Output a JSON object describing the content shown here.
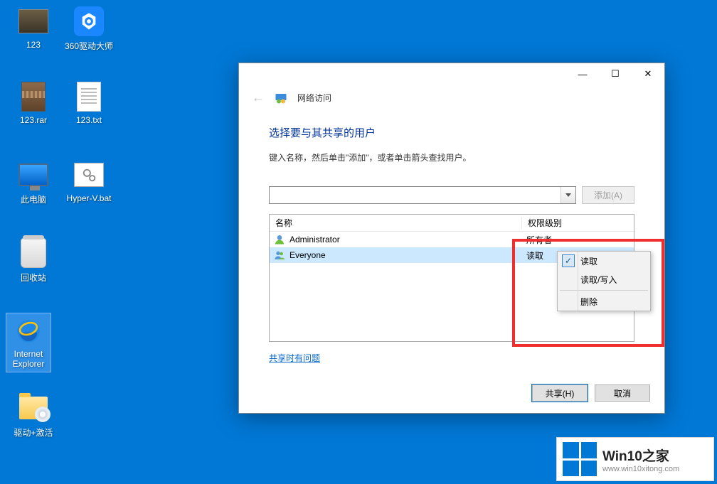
{
  "desktop": {
    "icons": [
      {
        "label": "123"
      },
      {
        "label": "360驱动大师"
      },
      {
        "label": "123.rar"
      },
      {
        "label": "123.txt"
      },
      {
        "label": "此电脑"
      },
      {
        "label": "Hyper-V.bat"
      },
      {
        "label": "回收站"
      },
      {
        "label": "Internet Explorer"
      },
      {
        "label": "驱动+激活"
      }
    ]
  },
  "dialog": {
    "header": "网络访问",
    "title": "选择要与其共享的用户",
    "description": "键入名称，然后单击\"添加\"，或者单击箭头查找用户。",
    "add_button": "添加(A)",
    "columns": {
      "name": "名称",
      "perm": "权限级别"
    },
    "users": [
      {
        "name": "Administrator",
        "perm": "所有者"
      },
      {
        "name": "Everyone",
        "perm": "读取"
      }
    ],
    "context_menu": {
      "read": "读取",
      "readwrite": "读取/写入",
      "remove": "删除"
    },
    "link": "共享时有问题",
    "buttons": {
      "share": "共享(H)",
      "cancel": "取消"
    }
  },
  "watermark": {
    "title": "Win10之家",
    "url": "www.win10xitong.com"
  }
}
